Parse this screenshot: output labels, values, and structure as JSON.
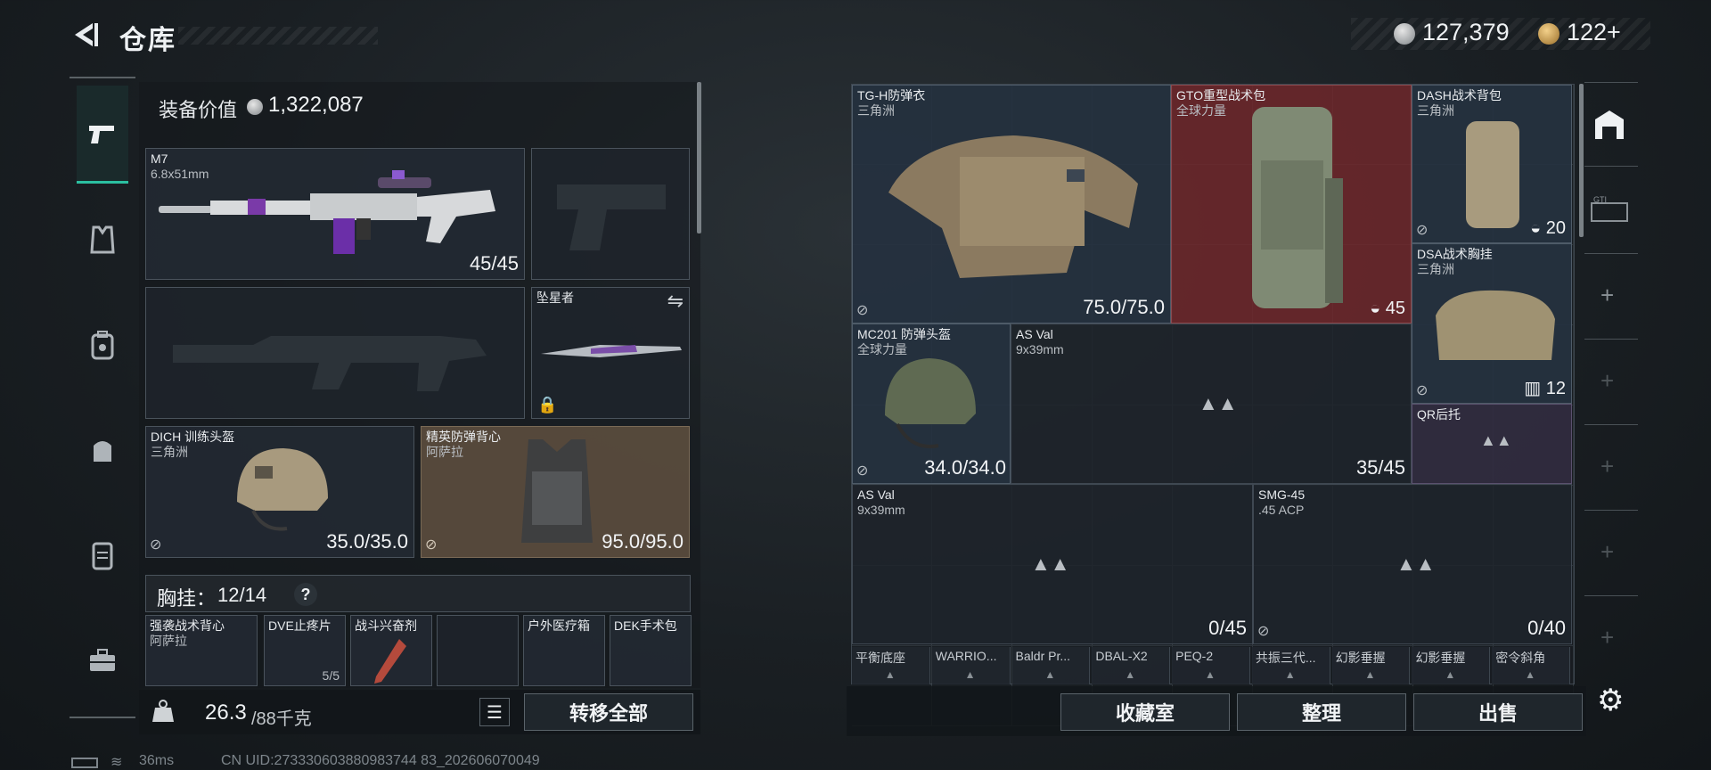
{
  "header": {
    "title": "仓库",
    "currency_silver": "127,379",
    "currency_gold": "122+"
  },
  "equipment": {
    "value_label": "装备价值",
    "value": "1,322,087",
    "primary_weapon": {
      "name": "M7",
      "caliber": "6.8x51mm",
      "ammo": "45/45"
    },
    "melee": {
      "name": "坠星者"
    },
    "helmet": {
      "name": "DICH 训练头盔",
      "origin": "三角洲",
      "durability": "35.0/35.0"
    },
    "armor": {
      "name": "精英防弹背心",
      "origin": "阿萨拉",
      "durability": "95.0/95.0"
    },
    "chest_rig": {
      "label": "胸挂：",
      "capacity": "12/14",
      "help": "?"
    },
    "rig_items": [
      {
        "name": "强袭战术背心",
        "sub": "阿萨拉"
      },
      {
        "name": "DVE止疼片",
        "sub": "5/5"
      },
      {
        "name": "战斗兴奋剂",
        "sub": ""
      },
      {
        "name": "",
        "sub": ""
      },
      {
        "name": "户外医疗箱",
        "sub": ""
      },
      {
        "name": "DEK手术包",
        "sub": ""
      }
    ],
    "weight": "26.3",
    "weight_max": "/88千克",
    "transfer_all": "转移全部"
  },
  "storage": {
    "items": [
      {
        "name": "TG-H防弹衣",
        "sub": "三角洲",
        "value": "75.0/75.0"
      },
      {
        "name": "GTO重型战术包",
        "sub": "全球力量",
        "value": "45"
      },
      {
        "name": "DASH战术背包",
        "sub": "三角洲",
        "value": "20"
      },
      {
        "name": "DSA战术胸挂",
        "sub": "三角洲",
        "value": "12"
      },
      {
        "name": "MC201 防弹头盔",
        "sub": "全球力量",
        "value": "34.0/34.0"
      },
      {
        "name": "AS Val",
        "sub": "9x39mm",
        "value": "35/45"
      },
      {
        "name": "QR后托",
        "sub": "",
        "value": ""
      },
      {
        "name": "AS Val",
        "sub": "9x39mm",
        "value": "0/45"
      },
      {
        "name": "SMG-45",
        "sub": ".45 ACP",
        "value": "0/40"
      }
    ],
    "bottom_row": [
      "平衡底座",
      "WARRIO...",
      "Baldr Pr...",
      "DBAL-X2",
      "PEQ-2",
      "共振三代...",
      "幻影垂握",
      "幻影垂握",
      "密令斜角"
    ],
    "buttons": {
      "collection": "收藏室",
      "sort": "整理",
      "sell": "出售"
    }
  },
  "footer": {
    "ping": "36ms",
    "uid": "CN UID:273330603880983744 83_202606070049"
  }
}
